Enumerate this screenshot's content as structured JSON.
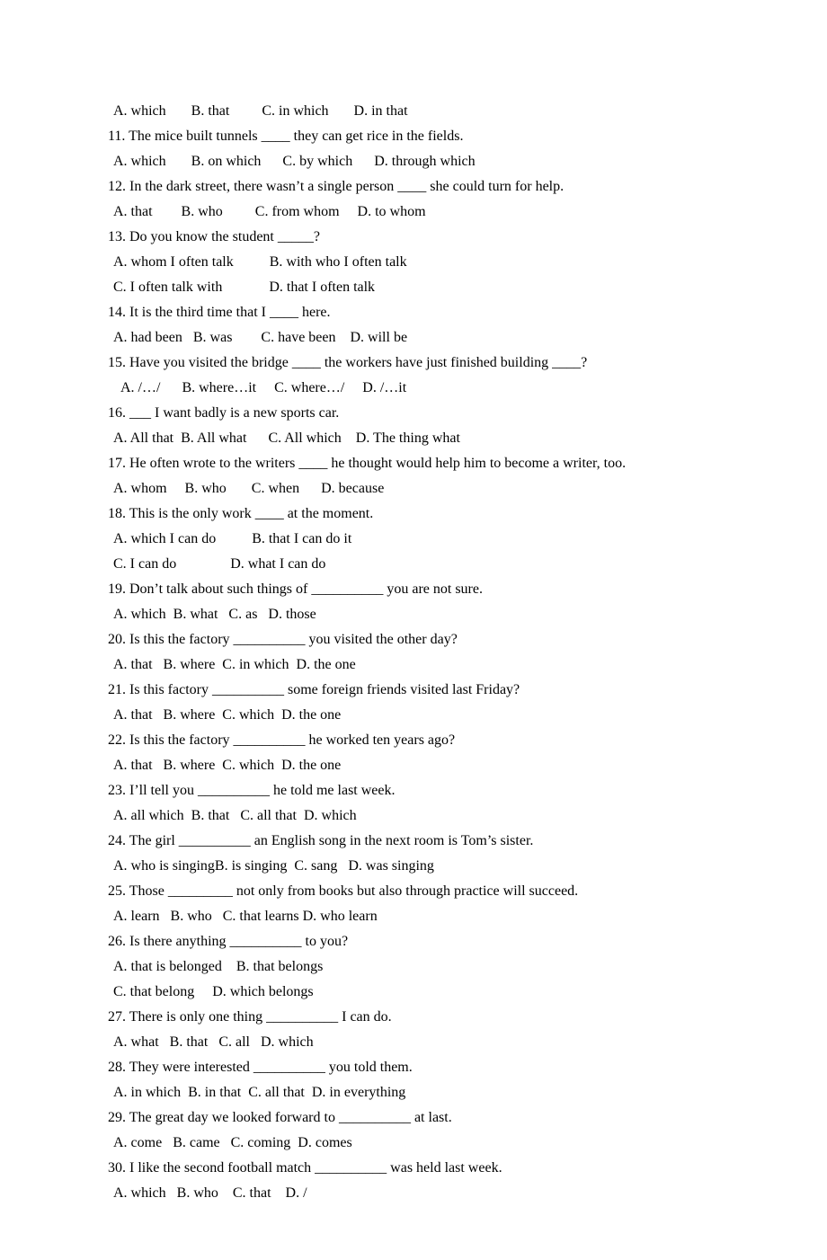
{
  "lines": [
    {
      "cls": "opts",
      "text": "A. which       B. that         C. in which       D. in that"
    },
    {
      "cls": "",
      "text": "11. The mice built tunnels ____ they can get rice in the fields."
    },
    {
      "cls": "opts",
      "text": "A. which       B. on which      C. by which      D. through which"
    },
    {
      "cls": "",
      "text": "12. In the dark street, there wasn’t a single person ____ she could turn for help."
    },
    {
      "cls": "opts",
      "text": "A. that        B. who         C. from whom     D. to whom"
    },
    {
      "cls": "",
      "text": "13. Do you know the student _____?"
    },
    {
      "cls": "opts",
      "text": "A. whom I often talk          B. with who I often talk"
    },
    {
      "cls": "opts",
      "text": "C. I often talk with             D. that I often talk"
    },
    {
      "cls": "",
      "text": "14. It is the third time that I ____ here."
    },
    {
      "cls": "opts",
      "text": "A. had been   B. was        C. have been    D. will be"
    },
    {
      "cls": "",
      "text": "15. Have you visited the bridge ____ the workers have just finished building ____?"
    },
    {
      "cls": "sub",
      "text": "A. /…/      B. where…it     C. where…/     D. /…it"
    },
    {
      "cls": "",
      "text": "16. ___ I want badly is a new sports car."
    },
    {
      "cls": "opts",
      "text": "A. All that  B. All what      C. All which    D. The thing what"
    },
    {
      "cls": "",
      "text": "17. He often wrote to the writers ____ he thought would help him to become a writer, too."
    },
    {
      "cls": "opts",
      "text": "A. whom     B. who       C. when      D. because"
    },
    {
      "cls": "",
      "text": "18. This is the only work ____ at the moment."
    },
    {
      "cls": "opts",
      "text": "A. which I can do          B. that I can do it"
    },
    {
      "cls": "opts",
      "text": "C. I can do               D. what I can do"
    },
    {
      "cls": "",
      "text": "19. Don’t talk about such things of __________ you are not sure."
    },
    {
      "cls": "opts",
      "text": "A. which  B. what   C. as   D. those"
    },
    {
      "cls": "",
      "text": "20. Is this the factory __________ you visited the other day?"
    },
    {
      "cls": "opts",
      "text": "A. that   B. where  C. in which  D. the one"
    },
    {
      "cls": "",
      "text": "21. Is this factory __________ some foreign friends visited last Friday?"
    },
    {
      "cls": "opts",
      "text": "A. that   B. where  C. which  D. the one"
    },
    {
      "cls": "",
      "text": "22. Is this the factory __________ he worked ten years ago?"
    },
    {
      "cls": "opts",
      "text": "A. that   B. where  C. which  D. the one"
    },
    {
      "cls": "",
      "text": "23. I’ll tell you __________ he told me last week."
    },
    {
      "cls": "opts",
      "text": "A. all which  B. that   C. all that  D. which"
    },
    {
      "cls": "",
      "text": "24. The girl __________ an English song in the next room is Tom’s sister."
    },
    {
      "cls": "opts",
      "text": "A. who is singingB. is singing  C. sang   D. was singing"
    },
    {
      "cls": "",
      "text": "25. Those _________ not only from books but also through practice will succeed."
    },
    {
      "cls": "opts",
      "text": "A. learn   B. who   C. that learns D. who learn"
    },
    {
      "cls": "",
      "text": "26. Is there anything __________ to you?"
    },
    {
      "cls": "opts",
      "text": "A. that is belonged    B. that belongs"
    },
    {
      "cls": "opts",
      "text": "C. that belong     D. which belongs"
    },
    {
      "cls": "",
      "text": "27. There is only one thing __________ I can do."
    },
    {
      "cls": "opts",
      "text": "A. what   B. that   C. all   D. which"
    },
    {
      "cls": "",
      "text": "28. They were interested __________ you told them."
    },
    {
      "cls": "opts",
      "text": "A. in which  B. in that  C. all that  D. in everything"
    },
    {
      "cls": "",
      "text": "29. The great day we looked forward to __________ at last."
    },
    {
      "cls": "opts",
      "text": "A. come   B. came   C. coming  D. comes"
    },
    {
      "cls": "",
      "text": "30. I like the second football match __________ was held last week."
    },
    {
      "cls": "opts",
      "text": "A. which   B. who    C. that    D. /"
    }
  ]
}
